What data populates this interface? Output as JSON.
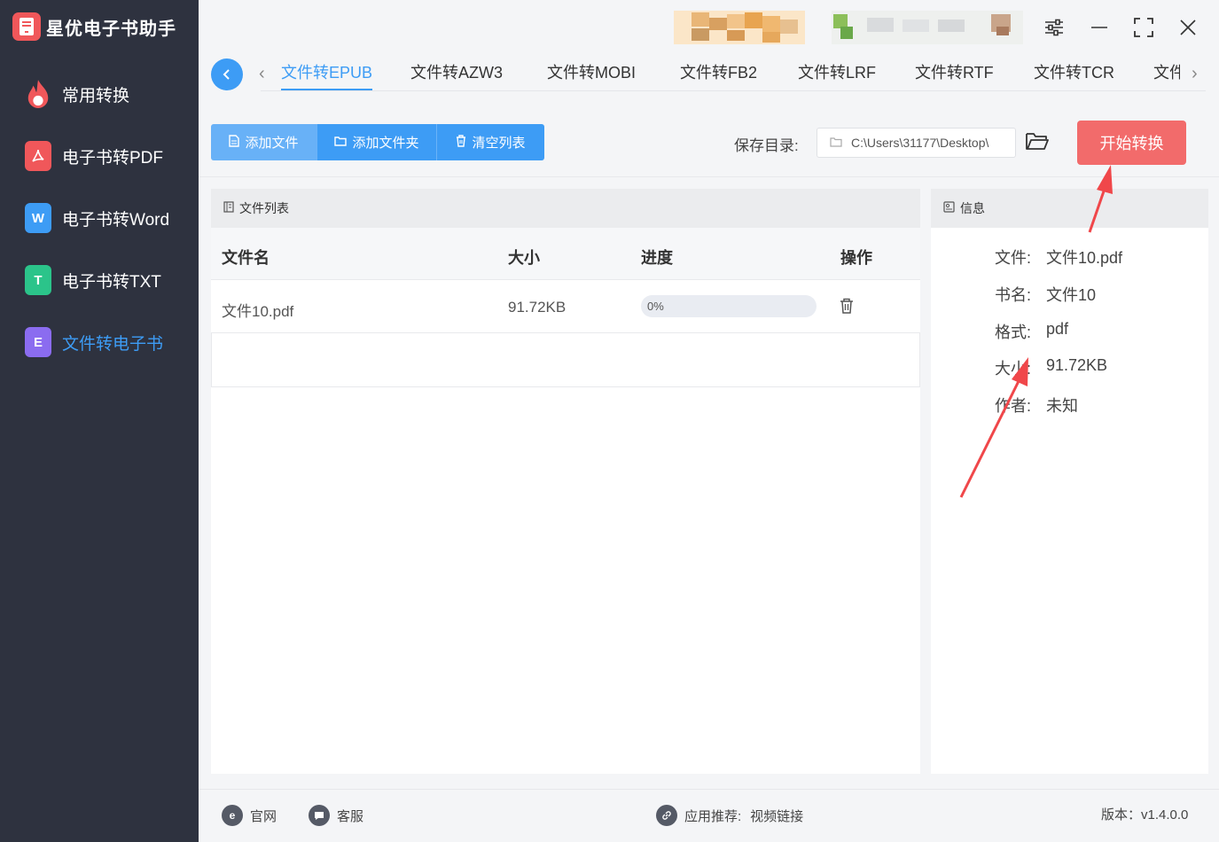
{
  "app": {
    "title": "星优电子书助手"
  },
  "sidebar": {
    "items": [
      {
        "label": "常用转换",
        "icon": "fire-icon",
        "color": "#f0575a"
      },
      {
        "label": "电子书转PDF",
        "icon": "pdf-icon",
        "color": "#f0575a"
      },
      {
        "label": "电子书转Word",
        "icon": "word-icon",
        "color": "#3d9cf5"
      },
      {
        "label": "电子书转TXT",
        "icon": "txt-icon",
        "color": "#2bc48a"
      },
      {
        "label": "文件转电子书",
        "icon": "ebook-icon",
        "color": "#8b6cf0",
        "active": true
      }
    ],
    "icon_letters": {
      "word": "W",
      "txt": "T",
      "ebook": "E"
    }
  },
  "tabs": [
    {
      "label": "文件转EPUB",
      "active": true
    },
    {
      "label": "文件转AZW3"
    },
    {
      "label": "文件转MOBI"
    },
    {
      "label": "文件转FB2"
    },
    {
      "label": "文件转LRF"
    },
    {
      "label": "文件转RTF"
    },
    {
      "label": "文件转TCR"
    },
    {
      "label": "文件"
    }
  ],
  "toolbar": {
    "add_file": "添加文件",
    "add_folder": "添加文件夹",
    "clear_list": "清空列表",
    "save_label": "保存目录:",
    "save_path": "C:\\Users\\31177\\Desktop\\",
    "start": "开始转换"
  },
  "file_list": {
    "title": "文件列表",
    "columns": [
      "文件名",
      "大小",
      "进度",
      "操作"
    ],
    "rows": [
      {
        "name": "文件10.pdf",
        "size": "91.72KB",
        "progress_label": "0%",
        "progress": 0
      }
    ]
  },
  "info": {
    "title": "信息",
    "fields": [
      {
        "key": "文件:",
        "value": "文件10.pdf"
      },
      {
        "key": "书名:",
        "value": "文件10"
      },
      {
        "key": "格式:",
        "value": "pdf"
      },
      {
        "key": "大小:",
        "value": "91.72KB"
      },
      {
        "key": "作者:",
        "value": "未知"
      }
    ]
  },
  "footer": {
    "website": "官网",
    "service": "客服",
    "recommend_label": "应用推荐:",
    "recommend_link": "视频链接",
    "version": "版本：v1.4.0.0"
  },
  "colors": {
    "accent": "#3d9cf5",
    "start": "#f26b6b",
    "sidebar": "#2e323f",
    "annotation": "#f0474a"
  }
}
